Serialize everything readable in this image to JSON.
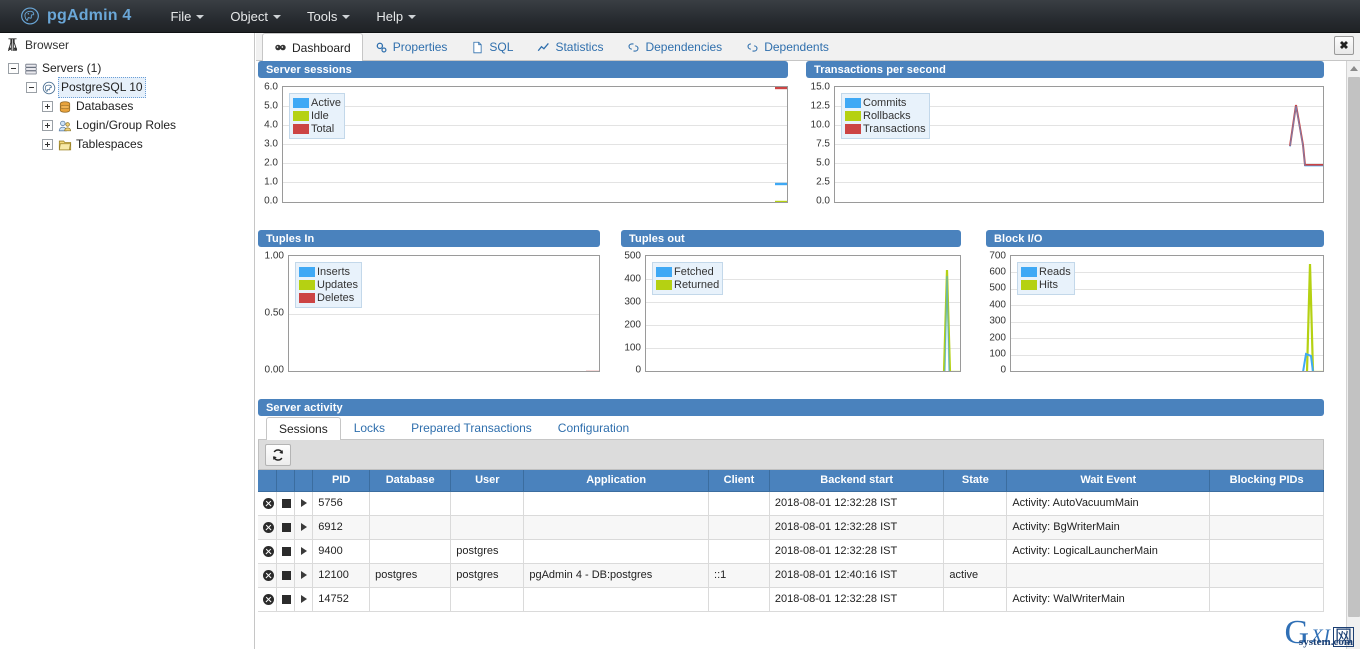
{
  "app": {
    "brand": "pgAdmin 4",
    "logo_icon": "pgadmin-elephant-logo",
    "menus": [
      {
        "label": "File"
      },
      {
        "label": "Object"
      },
      {
        "label": "Tools"
      },
      {
        "label": "Help"
      }
    ]
  },
  "browser": {
    "title": "Browser",
    "title_icon": "browser-icon",
    "tree": [
      {
        "label": "Servers (1)",
        "icon": "servers-icon",
        "level": 0,
        "expanded": true,
        "selected": false
      },
      {
        "label": "PostgreSQL 10",
        "icon": "postgresql-server-icon",
        "level": 1,
        "expanded": true,
        "selected": true
      },
      {
        "label": "Databases",
        "icon": "databases-icon",
        "level": 2,
        "expanded": false,
        "selected": false
      },
      {
        "label": "Login/Group Roles",
        "icon": "roles-icon",
        "level": 2,
        "expanded": false,
        "selected": false
      },
      {
        "label": "Tablespaces",
        "icon": "tablespaces-icon",
        "level": 2,
        "expanded": false,
        "selected": false
      }
    ]
  },
  "tabs": {
    "close_label": "✖",
    "items": [
      {
        "label": "Dashboard",
        "icon": "dashboard-icon",
        "active": true
      },
      {
        "label": "Properties",
        "icon": "properties-icon",
        "active": false
      },
      {
        "label": "SQL",
        "icon": "sql-icon",
        "active": false
      },
      {
        "label": "Statistics",
        "icon": "statistics-icon",
        "active": false
      },
      {
        "label": "Dependencies",
        "icon": "dependencies-icon",
        "active": false
      },
      {
        "label": "Dependents",
        "icon": "dependents-icon",
        "active": false
      }
    ]
  },
  "colors": {
    "panel_header": "#4a82bd",
    "series_blue": "#3fa9f5",
    "series_green": "#b5d112",
    "series_red": "#cc4444",
    "accent_link": "#2f6fad"
  },
  "chart_data": [
    {
      "type": "line",
      "title": "Server sessions",
      "xlabel": "",
      "ylabel": "",
      "ylim": [
        0,
        6
      ],
      "yticks": [
        "0.0",
        "1.0",
        "2.0",
        "3.0",
        "4.0",
        "5.0",
        "6.0"
      ],
      "grid": true,
      "legend_position": "top-left",
      "series": [
        {
          "name": "Active",
          "color": "#3fa9f5",
          "values": [
            null,
            null,
            null,
            null,
            null,
            null,
            null,
            null,
            1,
            1
          ]
        },
        {
          "name": "Idle",
          "color": "#b5d112",
          "values": [
            null,
            null,
            null,
            null,
            null,
            null,
            null,
            null,
            0,
            0
          ]
        },
        {
          "name": "Total",
          "color": "#cc4444",
          "values": [
            null,
            null,
            null,
            null,
            null,
            null,
            null,
            null,
            6,
            6
          ]
        }
      ]
    },
    {
      "type": "line",
      "title": "Transactions per second",
      "xlabel": "",
      "ylabel": "",
      "ylim": [
        0,
        15
      ],
      "yticks": [
        "0.0",
        "2.5",
        "5.0",
        "7.5",
        "10.0",
        "12.5",
        "15.0"
      ],
      "grid": true,
      "legend_position": "top-left",
      "series": [
        {
          "name": "Commits",
          "color": "#3fa9f5",
          "values": [
            null,
            null,
            null,
            null,
            null,
            null,
            null,
            7.5,
            13,
            5,
            5
          ]
        },
        {
          "name": "Rollbacks",
          "color": "#b5d112",
          "values": [
            null,
            null,
            null,
            null,
            null,
            null,
            null,
            0,
            0,
            0,
            0
          ]
        },
        {
          "name": "Transactions",
          "color": "#cc4444",
          "values": [
            null,
            null,
            null,
            null,
            null,
            null,
            null,
            7.5,
            13,
            5,
            5
          ]
        }
      ]
    },
    {
      "type": "line",
      "title": "Tuples In",
      "xlabel": "",
      "ylabel": "",
      "ylim": [
        0,
        1
      ],
      "yticks": [
        "0.00",
        "0.50",
        "1.00"
      ],
      "grid": true,
      "legend_position": "top-left",
      "series": [
        {
          "name": "Inserts",
          "color": "#3fa9f5",
          "values": [
            null,
            null,
            null,
            null,
            null,
            null,
            null,
            null,
            0,
            0
          ]
        },
        {
          "name": "Updates",
          "color": "#b5d112",
          "values": [
            null,
            null,
            null,
            null,
            null,
            null,
            null,
            null,
            0,
            0
          ]
        },
        {
          "name": "Deletes",
          "color": "#cc4444",
          "values": [
            null,
            null,
            null,
            null,
            null,
            null,
            null,
            null,
            0,
            0
          ]
        }
      ]
    },
    {
      "type": "line",
      "title": "Tuples out",
      "xlabel": "",
      "ylabel": "",
      "ylim": [
        0,
        500
      ],
      "yticks": [
        "0",
        "100",
        "200",
        "300",
        "400",
        "500"
      ],
      "grid": true,
      "legend_position": "top-left",
      "series": [
        {
          "name": "Fetched",
          "color": "#3fa9f5",
          "values": [
            null,
            null,
            null,
            null,
            null,
            null,
            null,
            0,
            430,
            0
          ]
        },
        {
          "name": "Returned",
          "color": "#b5d112",
          "values": [
            null,
            null,
            null,
            null,
            null,
            null,
            null,
            0,
            440,
            0
          ]
        }
      ]
    },
    {
      "type": "line",
      "title": "Block I/O",
      "xlabel": "",
      "ylabel": "",
      "ylim": [
        0,
        700
      ],
      "yticks": [
        "0",
        "100",
        "200",
        "300",
        "400",
        "500",
        "600",
        "700"
      ],
      "grid": true,
      "legend_position": "top-left",
      "series": [
        {
          "name": "Reads",
          "color": "#3fa9f5",
          "values": [
            null,
            null,
            null,
            null,
            null,
            null,
            null,
            0,
            110,
            0
          ]
        },
        {
          "name": "Hits",
          "color": "#b5d112",
          "values": [
            null,
            null,
            null,
            null,
            null,
            null,
            null,
            0,
            650,
            0
          ]
        }
      ]
    }
  ],
  "activity": {
    "title": "Server activity",
    "tabs": [
      {
        "label": "Sessions",
        "active": true
      },
      {
        "label": "Locks",
        "active": false
      },
      {
        "label": "Prepared Transactions",
        "active": false
      },
      {
        "label": "Configuration",
        "active": false
      }
    ],
    "refresh_icon": "refresh-icon",
    "columns": [
      "",
      "",
      "",
      "PID",
      "Database",
      "User",
      "Application",
      "Client",
      "Backend start",
      "State",
      "Wait Event",
      "Blocking PIDs"
    ],
    "rows": [
      {
        "pid": "5756",
        "database": "",
        "user": "",
        "application": "",
        "client": "",
        "backend_start": "2018-08-01 12:32:28 IST",
        "state": "",
        "wait_event": "Activity: AutoVacuumMain",
        "blocking_pids": ""
      },
      {
        "pid": "6912",
        "database": "",
        "user": "",
        "application": "",
        "client": "",
        "backend_start": "2018-08-01 12:32:28 IST",
        "state": "",
        "wait_event": "Activity: BgWriterMain",
        "blocking_pids": ""
      },
      {
        "pid": "9400",
        "database": "",
        "user": "postgres",
        "application": "",
        "client": "",
        "backend_start": "2018-08-01 12:32:28 IST",
        "state": "",
        "wait_event": "Activity: LogicalLauncherMain",
        "blocking_pids": ""
      },
      {
        "pid": "12100",
        "database": "postgres",
        "user": "postgres",
        "application": "pgAdmin 4 - DB:postgres",
        "client": "::1",
        "backend_start": "2018-08-01 12:40:16 IST",
        "state": "active",
        "wait_event": "",
        "blocking_pids": ""
      },
      {
        "pid": "14752",
        "database": "",
        "user": "",
        "application": "",
        "client": "",
        "backend_start": "2018-08-01 12:32:28 IST",
        "state": "",
        "wait_event": "Activity: WalWriterMain",
        "blocking_pids": ""
      }
    ]
  },
  "watermark": {
    "g": "G",
    "xi": "XI",
    "cn": "网",
    "domain": "system.com"
  }
}
